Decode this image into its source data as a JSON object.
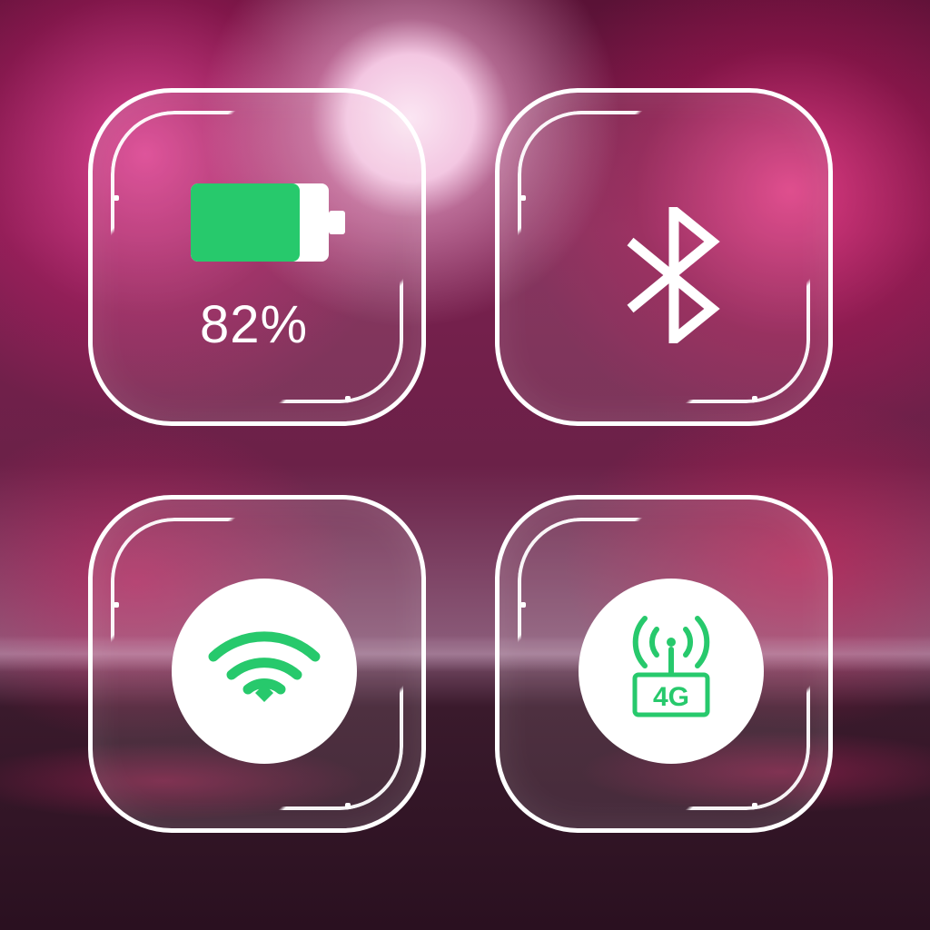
{
  "wallpaper": {
    "description_colors": {
      "sky": "#7a1f4e",
      "blossom": "#ff50aa",
      "moon": "#fbe6f3"
    }
  },
  "accent_color": "#27c96c",
  "tile_border_color": "#ffffff",
  "widgets": {
    "battery": {
      "icon": "battery-icon",
      "level_fraction": 0.82,
      "percentage_label": "82%"
    },
    "bluetooth": {
      "icon": "bluetooth-icon"
    },
    "wifi": {
      "icon": "wifi-icon"
    },
    "cellular": {
      "icon": "4g-tower-icon",
      "label": "4G"
    }
  }
}
